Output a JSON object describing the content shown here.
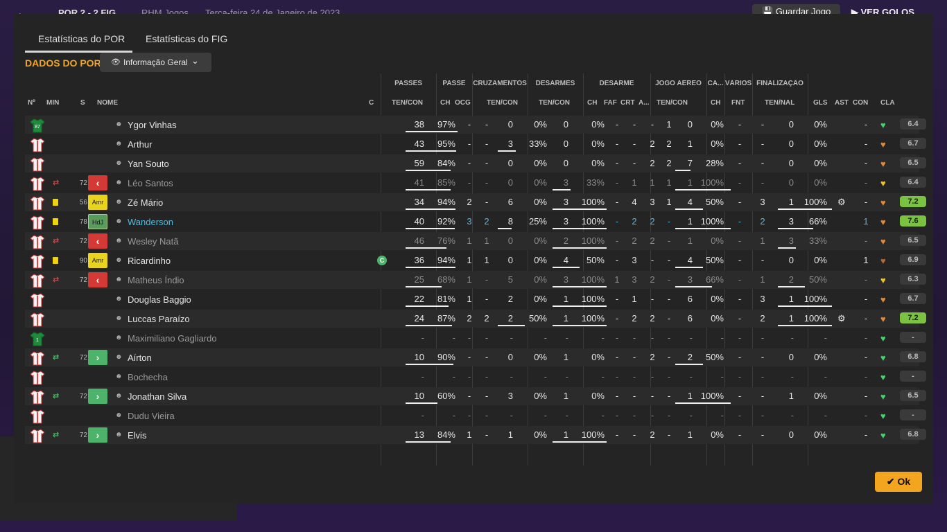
{
  "topbar": {
    "back_icon": "arrow-left-icon",
    "score": "POR 2 - 2 FIG",
    "rhm": "RHM Jogos",
    "date": "Terça-feira 24 de Janeiro de 2023",
    "save_label": "Guardar Jogo",
    "next_label": "VER GOLOS"
  },
  "tabs": [
    "Estatísticas do POR",
    "Estatísticas do FIG"
  ],
  "section_title": "DADOS DO POR",
  "dropdown_value": "Informação Geral",
  "groups": [
    "PASSES",
    "PASSE",
    "CRUZAMENTOS",
    "DESARMES",
    "DESARME",
    "JOGO AÉREO",
    "CA...",
    "VÁRIOS",
    "FINALIZAÇÃO"
  ],
  "headers": {
    "num": "Nº",
    "min": "MIN",
    "s": "S",
    "nome": "NOME",
    "c": "C",
    "passes": "TEN/CON",
    "passe_ch": "CH",
    "passe_ocg": "OCG",
    "cruz": "TEN/CON",
    "desarmes": "TEN/CON",
    "des_ch": "CH",
    "des_faf": "FAF",
    "des_crt": "CRT",
    "des_a": "A...",
    "aereo": "TEN/CON",
    "ca_ch": "CH",
    "varios_fnt": "FNT",
    "final": "TEN/NAL",
    "gls": "GLS",
    "ast": "AST",
    "con": "CON",
    "cla": "CLA"
  },
  "colors": {
    "accent": "#f3a520",
    "link": "#5ab8d8",
    "rating_good": "#7bc242"
  },
  "players": [
    {
      "num": "87",
      "gk": true,
      "min": "",
      "sub": "",
      "card": false,
      "s": "",
      "name": "Ygor Vinhas",
      "c": "",
      "pas": [
        "38",
        "97%"
      ],
      "pas_fill": 0.97,
      "p_ch": "-",
      "p_ocg": "-",
      "cru": [
        "0",
        "0%"
      ],
      "cru_fill": 0,
      "des": [
        "0",
        "0%"
      ],
      "des_fill": 0,
      "d_ch": "-",
      "d_faf": "-",
      "d_crt": "-",
      "d_a": "1",
      "aer": [
        "0",
        "0%"
      ],
      "aer_fill": 0,
      "ca_ch": "-",
      "fnt": "-",
      "fin": [
        "0",
        "0%"
      ],
      "fin_fill": 0,
      "gls": "",
      "ast": "-",
      "con": "green",
      "cla": "6.4",
      "good": false,
      "dim": false,
      "hi": false
    },
    {
      "num": "",
      "gk": false,
      "min": "",
      "sub": "",
      "card": false,
      "s": "",
      "name": "Arthur",
      "c": "",
      "pas": [
        "43",
        "95%"
      ],
      "pas_fill": 0.95,
      "p_ch": "-",
      "p_ocg": "-",
      "cru": [
        "3",
        "33%"
      ],
      "cru_fill": 0.33,
      "des": [
        "0",
        "0%"
      ],
      "des_fill": 0,
      "d_ch": "-",
      "d_faf": "-",
      "d_crt": "2",
      "d_a": "2",
      "aer": [
        "1",
        "0%"
      ],
      "aer_fill": 0,
      "ca_ch": "-",
      "fnt": "-",
      "fin": [
        "0",
        "0%"
      ],
      "fin_fill": 0,
      "gls": "",
      "ast": "-",
      "con": "orange",
      "cla": "6.7",
      "good": false,
      "dim": false,
      "hi": false
    },
    {
      "num": "",
      "gk": false,
      "min": "",
      "sub": "",
      "card": false,
      "s": "",
      "name": "Yan Souto",
      "c": "",
      "pas": [
        "59",
        "84%"
      ],
      "pas_fill": 0.84,
      "p_ch": "-",
      "p_ocg": "-",
      "cru": [
        "0",
        "0%"
      ],
      "cru_fill": 0,
      "des": [
        "0",
        "0%"
      ],
      "des_fill": 0,
      "d_ch": "-",
      "d_faf": "-",
      "d_crt": "2",
      "d_a": "2",
      "aer": [
        "7",
        "28%"
      ],
      "aer_fill": 0.28,
      "ca_ch": "-",
      "fnt": "-",
      "fin": [
        "0",
        "0%"
      ],
      "fin_fill": 0,
      "gls": "",
      "ast": "-",
      "con": "orange",
      "cla": "6.5",
      "good": false,
      "dim": false,
      "hi": false
    },
    {
      "num": "",
      "gk": false,
      "min": "72",
      "sub": "out",
      "card": false,
      "s": "out",
      "name": "Léo Santos",
      "c": "",
      "pas": [
        "41",
        "85%"
      ],
      "pas_fill": 0.85,
      "p_ch": "-",
      "p_ocg": "-",
      "cru": [
        "0",
        "0%"
      ],
      "cru_fill": 0,
      "des": [
        "3",
        "33%"
      ],
      "des_fill": 0.33,
      "d_ch": "-",
      "d_faf": "1",
      "d_crt": "1",
      "d_a": "1",
      "aer": [
        "1",
        "100%"
      ],
      "aer_fill": 1,
      "ca_ch": "-",
      "fnt": "-",
      "fin": [
        "0",
        "0%"
      ],
      "fin_fill": 0,
      "gls": "",
      "ast": "-",
      "con": "yellow",
      "cla": "6.4",
      "good": false,
      "dim": true,
      "hi": false
    },
    {
      "num": "",
      "gk": false,
      "min": "56",
      "sub": "",
      "card": true,
      "s": "Amr",
      "name": "Zé Mário",
      "c": "",
      "pas": [
        "34",
        "94%"
      ],
      "pas_fill": 0.94,
      "p_ch": "2",
      "p_ocg": "-",
      "cru": [
        "6",
        "0%"
      ],
      "cru_fill": 0,
      "des": [
        "3",
        "100%"
      ],
      "des_fill": 1,
      "d_ch": "-",
      "d_faf": "4",
      "d_crt": "3",
      "d_a": "1",
      "aer": [
        "4",
        "50%"
      ],
      "aer_fill": 0.5,
      "ca_ch": "-",
      "fnt": "3",
      "fin": [
        "1",
        "100%"
      ],
      "fin_fill": 1,
      "gls": "gear",
      "ast": "-",
      "con": "orange",
      "cla": "7.2",
      "good": true,
      "dim": false,
      "hi": false
    },
    {
      "num": "",
      "gk": false,
      "min": "78",
      "sub": "",
      "card": true,
      "s": "HdJ",
      "name": "Wanderson",
      "c": "",
      "pas": [
        "40",
        "92%"
      ],
      "pas_fill": 0.92,
      "p_ch": "3",
      "p_ocg": "2",
      "cru": [
        "8",
        "25%"
      ],
      "cru_fill": 0.25,
      "des": [
        "3",
        "100%"
      ],
      "des_fill": 1,
      "d_ch": "-",
      "d_faf": "2",
      "d_crt": "2",
      "d_a": "-",
      "aer": [
        "1",
        "100%"
      ],
      "aer_fill": 1,
      "ca_ch": "-",
      "fnt": "2",
      "fin": [
        "3",
        "66%"
      ],
      "fin_fill": 0.66,
      "gls": "",
      "ast": "1",
      "con": "orange",
      "cla": "7.6",
      "good": true,
      "dim": false,
      "hi": true
    },
    {
      "num": "",
      "gk": false,
      "min": "72",
      "sub": "out",
      "card": false,
      "s": "out",
      "name": "Wesley Natã",
      "c": "",
      "pas": [
        "46",
        "76%"
      ],
      "pas_fill": 0.76,
      "p_ch": "1",
      "p_ocg": "1",
      "cru": [
        "0",
        "0%"
      ],
      "cru_fill": 0,
      "des": [
        "2",
        "100%"
      ],
      "des_fill": 1,
      "d_ch": "-",
      "d_faf": "2",
      "d_crt": "2",
      "d_a": "-",
      "aer": [
        "1",
        "0%"
      ],
      "aer_fill": 0,
      "ca_ch": "-",
      "fnt": "1",
      "fin": [
        "3",
        "33%"
      ],
      "fin_fill": 0.33,
      "gls": "",
      "ast": "-",
      "con": "orange",
      "cla": "6.5",
      "good": false,
      "dim": true,
      "hi": false
    },
    {
      "num": "",
      "gk": false,
      "min": "90",
      "sub": "",
      "card": true,
      "s": "Amr",
      "name": "Ricardinho",
      "c": "C",
      "pas": [
        "36",
        "94%"
      ],
      "pas_fill": 0.94,
      "p_ch": "1",
      "p_ocg": "1",
      "cru": [
        "0",
        "0%"
      ],
      "cru_fill": 0,
      "des": [
        "4",
        "50%"
      ],
      "des_fill": 0.5,
      "d_ch": "-",
      "d_faf": "3",
      "d_crt": "-",
      "d_a": "-",
      "aer": [
        "4",
        "50%"
      ],
      "aer_fill": 0.5,
      "ca_ch": "-",
      "fnt": "-",
      "fin": [
        "0",
        "0%"
      ],
      "fin_fill": 0,
      "gls": "",
      "ast": "1",
      "con": "brown",
      "cla": "6.9",
      "good": false,
      "dim": false,
      "hi": false
    },
    {
      "num": "",
      "gk": false,
      "min": "72",
      "sub": "out",
      "card": false,
      "s": "out",
      "name": "Matheus Índio",
      "c": "",
      "pas": [
        "25",
        "68%"
      ],
      "pas_fill": 0.68,
      "p_ch": "1",
      "p_ocg": "-",
      "cru": [
        "5",
        "0%"
      ],
      "cru_fill": 0,
      "des": [
        "3",
        "100%"
      ],
      "des_fill": 1,
      "d_ch": "1",
      "d_faf": "3",
      "d_crt": "2",
      "d_a": "-",
      "aer": [
        "3",
        "66%"
      ],
      "aer_fill": 0.66,
      "ca_ch": "-",
      "fnt": "1",
      "fin": [
        "2",
        "50%"
      ],
      "fin_fill": 0.5,
      "gls": "",
      "ast": "-",
      "con": "yellow",
      "cla": "6.3",
      "good": false,
      "dim": true,
      "hi": false
    },
    {
      "num": "",
      "gk": false,
      "min": "",
      "sub": "",
      "card": false,
      "s": "",
      "name": "Douglas Baggio",
      "c": "",
      "pas": [
        "22",
        "81%"
      ],
      "pas_fill": 0.81,
      "p_ch": "1",
      "p_ocg": "-",
      "cru": [
        "2",
        "0%"
      ],
      "cru_fill": 0,
      "des": [
        "1",
        "100%"
      ],
      "des_fill": 1,
      "d_ch": "-",
      "d_faf": "1",
      "d_crt": "-",
      "d_a": "-",
      "aer": [
        "6",
        "0%"
      ],
      "aer_fill": 0,
      "ca_ch": "-",
      "fnt": "3",
      "fin": [
        "1",
        "100%"
      ],
      "fin_fill": 1,
      "gls": "",
      "ast": "-",
      "con": "orange",
      "cla": "6.7",
      "good": false,
      "dim": false,
      "hi": false
    },
    {
      "num": "",
      "gk": false,
      "min": "",
      "sub": "",
      "card": false,
      "s": "",
      "name": "Luccas Paraízo",
      "c": "",
      "pas": [
        "24",
        "87%"
      ],
      "pas_fill": 0.87,
      "p_ch": "2",
      "p_ocg": "2",
      "cru": [
        "2",
        "50%"
      ],
      "cru_fill": 0.5,
      "des": [
        "1",
        "100%"
      ],
      "des_fill": 1,
      "d_ch": "-",
      "d_faf": "2",
      "d_crt": "2",
      "d_a": "-",
      "aer": [
        "6",
        "0%"
      ],
      "aer_fill": 0,
      "ca_ch": "-",
      "fnt": "2",
      "fin": [
        "1",
        "100%"
      ],
      "fin_fill": 1,
      "gls": "gear",
      "ast": "-",
      "con": "orange",
      "cla": "7.2",
      "good": true,
      "dim": false,
      "hi": false
    },
    {
      "num": "1",
      "gk": true,
      "min": "",
      "sub": "",
      "card": false,
      "s": "",
      "name": "Maximiliano Gagliardo",
      "c": "",
      "pas": [
        "-",
        "-"
      ],
      "pas_fill": 0,
      "p_ch": "-",
      "p_ocg": "-",
      "cru": [
        "-",
        "-"
      ],
      "cru_fill": 0,
      "des": [
        "-",
        "-"
      ],
      "des_fill": 0,
      "d_ch": "-",
      "d_faf": "-",
      "d_crt": "-",
      "d_a": "-",
      "aer": [
        "-",
        "-"
      ],
      "aer_fill": 0,
      "ca_ch": "-",
      "fnt": "-",
      "fin": [
        "-",
        "-"
      ],
      "fin_fill": 0,
      "gls": "",
      "ast": "-",
      "con": "green",
      "cla": "-",
      "good": false,
      "dim": true,
      "hi": false
    },
    {
      "num": "",
      "gk": false,
      "min": "72",
      "sub": "in",
      "card": false,
      "s": "in",
      "name": "Aírton",
      "c": "",
      "pas": [
        "10",
        "90%"
      ],
      "pas_fill": 0.9,
      "p_ch": "-",
      "p_ocg": "-",
      "cru": [
        "0",
        "0%"
      ],
      "cru_fill": 0,
      "des": [
        "1",
        "0%"
      ],
      "des_fill": 0,
      "d_ch": "-",
      "d_faf": "-",
      "d_crt": "2",
      "d_a": "-",
      "aer": [
        "2",
        "50%"
      ],
      "aer_fill": 0.5,
      "ca_ch": "-",
      "fnt": "-",
      "fin": [
        "0",
        "0%"
      ],
      "fin_fill": 0,
      "gls": "",
      "ast": "-",
      "con": "green",
      "cla": "6.8",
      "good": false,
      "dim": false,
      "hi": false
    },
    {
      "num": "",
      "gk": false,
      "min": "",
      "sub": "",
      "card": false,
      "s": "",
      "name": "Bochecha",
      "c": "",
      "pas": [
        "-",
        "-"
      ],
      "pas_fill": 0,
      "p_ch": "-",
      "p_ocg": "-",
      "cru": [
        "-",
        "-"
      ],
      "cru_fill": 0,
      "des": [
        "-",
        "-"
      ],
      "des_fill": 0,
      "d_ch": "-",
      "d_faf": "-",
      "d_crt": "-",
      "d_a": "-",
      "aer": [
        "-",
        "-"
      ],
      "aer_fill": 0,
      "ca_ch": "-",
      "fnt": "-",
      "fin": [
        "-",
        "-"
      ],
      "fin_fill": 0,
      "gls": "",
      "ast": "-",
      "con": "green",
      "cla": "-",
      "good": false,
      "dim": true,
      "hi": false
    },
    {
      "num": "",
      "gk": false,
      "min": "72",
      "sub": "in",
      "card": false,
      "s": "in",
      "name": "Jonathan Silva",
      "c": "",
      "pas": [
        "10",
        "60%"
      ],
      "pas_fill": 0.6,
      "p_ch": "-",
      "p_ocg": "-",
      "cru": [
        "3",
        "0%"
      ],
      "cru_fill": 0,
      "des": [
        "1",
        "0%"
      ],
      "des_fill": 0,
      "d_ch": "-",
      "d_faf": "-",
      "d_crt": "-",
      "d_a": "-",
      "aer": [
        "1",
        "100%"
      ],
      "aer_fill": 1,
      "ca_ch": "-",
      "fnt": "-",
      "fin": [
        "1",
        "0%"
      ],
      "fin_fill": 0,
      "gls": "",
      "ast": "-",
      "con": "green",
      "cla": "6.5",
      "good": false,
      "dim": false,
      "hi": false
    },
    {
      "num": "",
      "gk": false,
      "min": "",
      "sub": "",
      "card": false,
      "s": "",
      "name": "Dudu Vieira",
      "c": "",
      "pas": [
        "-",
        "-"
      ],
      "pas_fill": 0,
      "p_ch": "-",
      "p_ocg": "-",
      "cru": [
        "-",
        "-"
      ],
      "cru_fill": 0,
      "des": [
        "-",
        "-"
      ],
      "des_fill": 0,
      "d_ch": "-",
      "d_faf": "-",
      "d_crt": "-",
      "d_a": "-",
      "aer": [
        "-",
        "-"
      ],
      "aer_fill": 0,
      "ca_ch": "-",
      "fnt": "-",
      "fin": [
        "-",
        "-"
      ],
      "fin_fill": 0,
      "gls": "",
      "ast": "-",
      "con": "green",
      "cla": "-",
      "good": false,
      "dim": true,
      "hi": false
    },
    {
      "num": "",
      "gk": false,
      "min": "72",
      "sub": "in",
      "card": false,
      "s": "in",
      "name": "Elvis",
      "c": "",
      "pas": [
        "13",
        "84%"
      ],
      "pas_fill": 0.84,
      "p_ch": "1",
      "p_ocg": "-",
      "cru": [
        "1",
        "0%"
      ],
      "cru_fill": 0,
      "des": [
        "1",
        "100%"
      ],
      "des_fill": 1,
      "d_ch": "-",
      "d_faf": "-",
      "d_crt": "2",
      "d_a": "-",
      "aer": [
        "1",
        "0%"
      ],
      "aer_fill": 0,
      "ca_ch": "-",
      "fnt": "-",
      "fin": [
        "0",
        "0%"
      ],
      "fin_fill": 0,
      "gls": "",
      "ast": "-",
      "con": "green",
      "cla": "6.8",
      "good": false,
      "dim": false,
      "hi": false
    }
  ],
  "ok_label": "Ok"
}
